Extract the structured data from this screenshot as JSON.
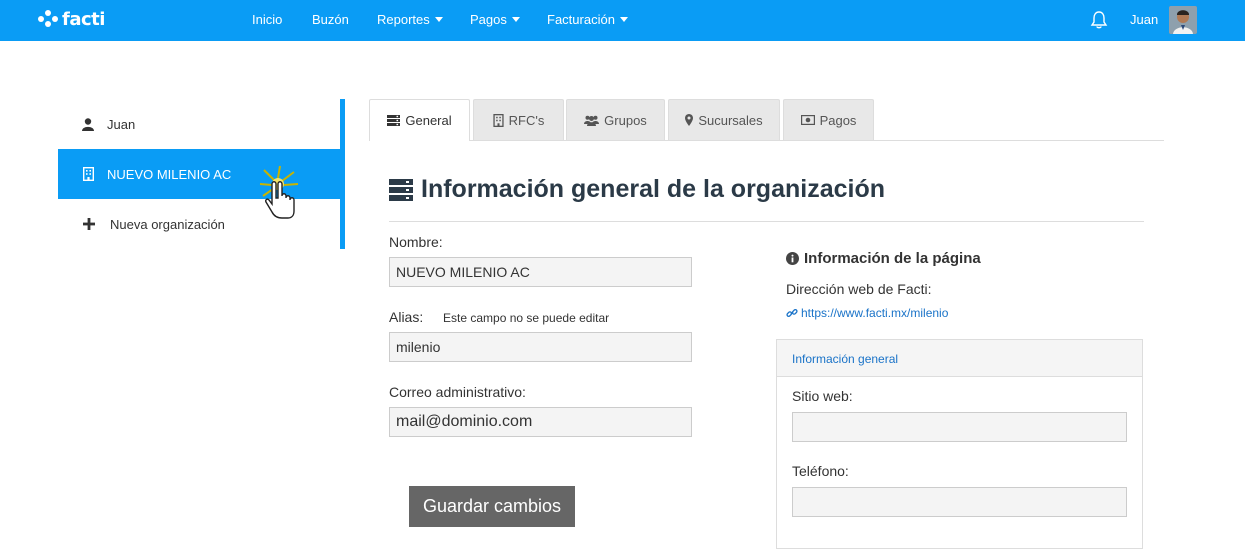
{
  "navbar": {
    "brand": "facti",
    "items": [
      {
        "label": "Inicio",
        "dropdown": false
      },
      {
        "label": "Buzón",
        "dropdown": false
      },
      {
        "label": "Reportes",
        "dropdown": true
      },
      {
        "label": "Pagos",
        "dropdown": true
      },
      {
        "label": "Facturación",
        "dropdown": true
      }
    ],
    "user_name": "Juan",
    "accent_color": "#0a9cf5"
  },
  "sidebar": {
    "items": [
      {
        "label": "Juan",
        "icon": "user-icon",
        "active": false
      },
      {
        "label": "NUEVO MILENIO AC",
        "icon": "building-icon",
        "active": true
      },
      {
        "label": "Nueva organización",
        "icon": "plus-icon",
        "active": false
      }
    ]
  },
  "tabs": [
    {
      "label": "General",
      "icon": "server-icon",
      "active": true
    },
    {
      "label": "RFC's",
      "icon": "building-icon",
      "active": false
    },
    {
      "label": "Grupos",
      "icon": "users-icon",
      "active": false
    },
    {
      "label": "Sucursales",
      "icon": "map-marker-icon",
      "active": false
    },
    {
      "label": "Pagos",
      "icon": "money-icon",
      "active": false
    }
  ],
  "main": {
    "heading": "Información general de la organización",
    "form": {
      "name_label": "Nombre:",
      "name_value": "NUEVO MILENIO AC",
      "alias_label": "Alias:",
      "alias_hint": "Este campo no se puede editar",
      "alias_value": "milenio",
      "email_label": "Correo administrativo:",
      "email_value": "mail@dominio.com",
      "save_label": "Guardar cambios"
    }
  },
  "info": {
    "title": "Información de la página",
    "address_label": "Dirección web de Facti:",
    "url": "https://www.facti.mx/milenio",
    "panel": {
      "heading": "Información general",
      "website_label": "Sitio web:",
      "website_value": "",
      "phone_label": "Teléfono:",
      "phone_value": ""
    }
  }
}
